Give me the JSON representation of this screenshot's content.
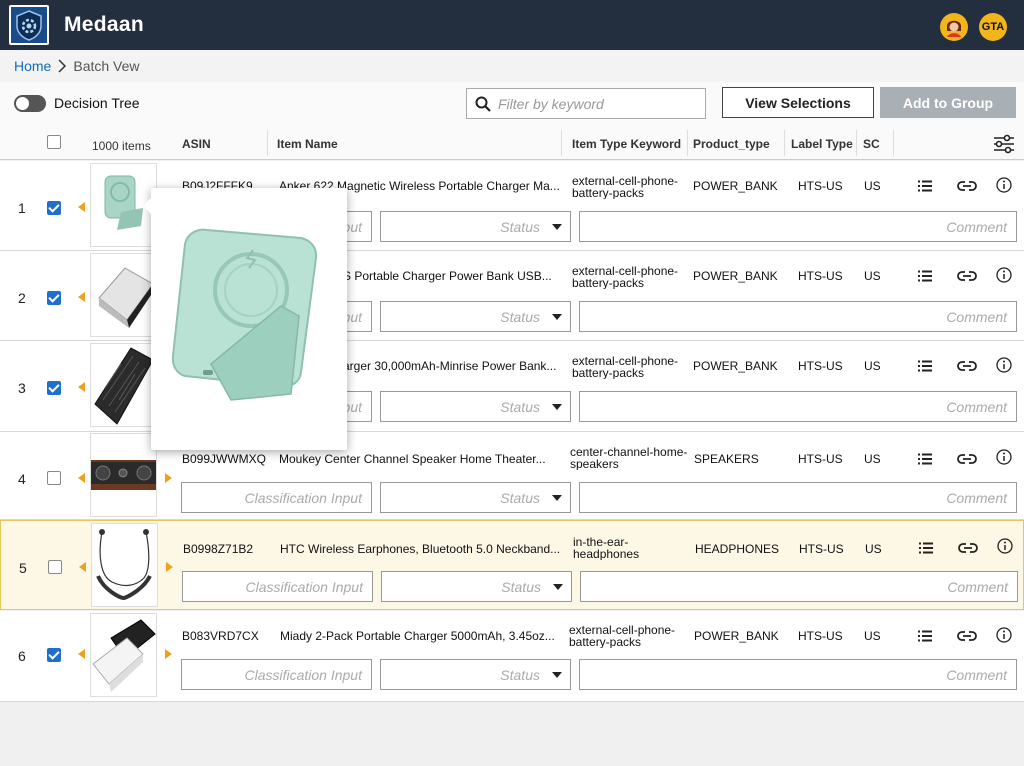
{
  "app": {
    "title": "Medaan"
  },
  "header": {
    "avatars": [
      {
        "name": "user-avatar"
      },
      {
        "label": "GTA"
      }
    ]
  },
  "breadcrumb": {
    "home": "Home",
    "current": "Batch Vew"
  },
  "toolbar": {
    "toggle_label": "Decision Tree",
    "toggle_on": false,
    "search_placeholder": "Filter by keyword",
    "view_selections": "View Selections",
    "add_to_group": "Add to Group"
  },
  "columns": {
    "count": "1000 items",
    "asin": "ASIN",
    "item_name": "Item Name",
    "item_type_keyword": "Item Type Keyword",
    "product_type": "Product_type",
    "label_type": "Label Type",
    "sc": "SC"
  },
  "placeholders": {
    "classification": "Classification Input",
    "status": "Status",
    "comment": "Comment",
    "classification_partial": "put"
  },
  "rows": [
    {
      "num": "1",
      "checked": true,
      "asin": "B09J2FFFK9",
      "name": "Anker 622 Magnetic Wireless Portable Charger Ma...",
      "keyword": "external-cell-phone-battery-packs",
      "ptype": "POWER_BANK",
      "label": "HTS-US",
      "sc": "US",
      "thumb": "green-magnetic-charger"
    },
    {
      "num": "2",
      "checked": true,
      "asin": "",
      "name": "S Portable Charger Power Bank USB...",
      "keyword": "external-cell-phone-battery-packs",
      "ptype": "POWER_BANK",
      "label": "HTS-US",
      "sc": "US",
      "thumb": "silver-power-bank"
    },
    {
      "num": "3",
      "checked": true,
      "asin": "",
      "name": "arger 30,000mAh-Minrise Power Bank...",
      "keyword": "external-cell-phone-battery-packs",
      "ptype": "POWER_BANK",
      "label": "HTS-US",
      "sc": "US",
      "thumb": "black-solar-power-bank"
    },
    {
      "num": "4",
      "checked": false,
      "asin": "B099JWWMXQ",
      "name": "Moukey Center Channel Speaker Home Theater...",
      "keyword": "center-channel-home-speakers",
      "ptype": "SPEAKERS",
      "label": "HTS-US",
      "sc": "US",
      "thumb": "center-speaker"
    },
    {
      "num": "5",
      "checked": false,
      "asin": "B0998Z71B2",
      "name": "HTC Wireless Earphones, Bluetooth 5.0 Neckband...",
      "keyword": "in-the-ear-headphones",
      "ptype": "HEADPHONES",
      "label": "HTS-US",
      "sc": "US",
      "thumb": "neckband-earphones"
    },
    {
      "num": "6",
      "checked": true,
      "asin": "B083VRD7CX",
      "name": "Miady 2-Pack Portable Charger 5000mAh, 3.45oz...",
      "keyword": "external-cell-phone-battery-packs",
      "ptype": "POWER_BANK",
      "label": "HTS-US",
      "sc": "US",
      "thumb": "two-power-banks"
    }
  ],
  "colors": {
    "topbar": "#232f3e",
    "accent": "#f0a020",
    "link": "#0f6cbd",
    "checkbox": "#1f6fcf",
    "highlight_row": "#fdf7e6"
  }
}
